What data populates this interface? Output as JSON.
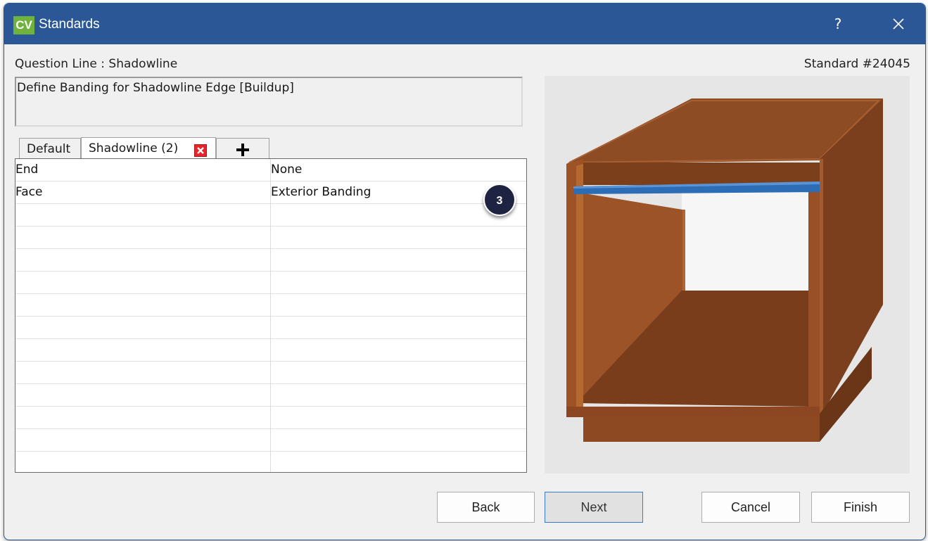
{
  "window": {
    "logo": "CV",
    "title": "Standards",
    "help": "?",
    "close_icon": "close-icon"
  },
  "header": {
    "question_line": "Question Line : Shadowline",
    "standard_number": "Standard #24045"
  },
  "description": "Define Banding for Shadowline Edge [Buildup]",
  "tabs": [
    {
      "label": "Default"
    },
    {
      "label": "Shadowline (2)",
      "active": true
    },
    {
      "label": "+"
    }
  ],
  "grid": {
    "rows": [
      {
        "name": "End",
        "value": "None"
      },
      {
        "name": "Face",
        "value": "Exterior Banding"
      }
    ]
  },
  "badge": "3",
  "buttons": {
    "back": "Back",
    "next": "Next",
    "cancel": "Cancel",
    "finish": "Finish"
  },
  "colors": {
    "titlebar": "#2b5797",
    "logo": "#6fb33d",
    "cabinet_light": "#a65a2b",
    "cabinet_dark": "#7b3f1c",
    "banding": "#2d6db5",
    "badge": "#1d2341"
  }
}
